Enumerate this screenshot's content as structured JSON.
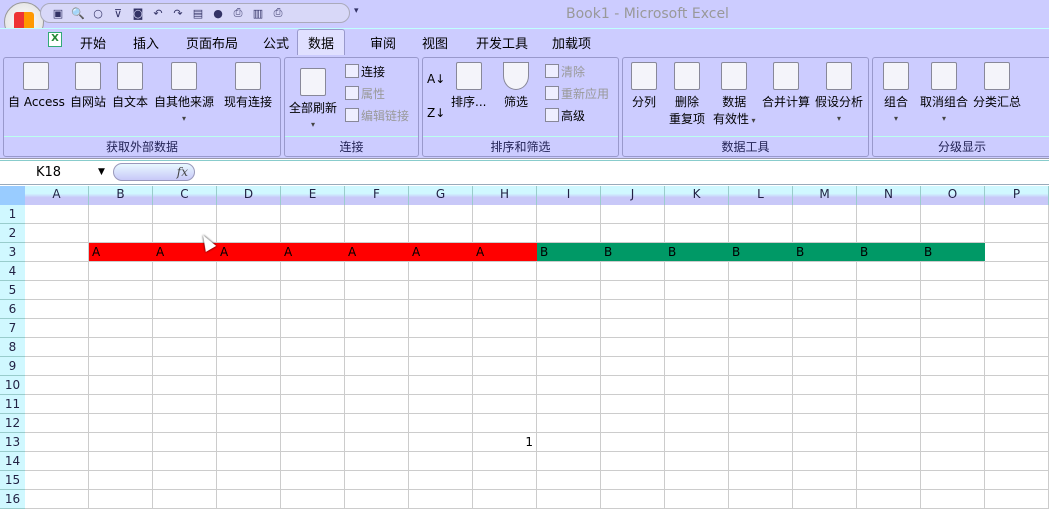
{
  "window": {
    "title": "Book1 - Microsoft Excel"
  },
  "quick_access": [
    "save-icon",
    "print-preview-icon",
    "circle-icon",
    "filter-icon",
    "camera-icon",
    "undo-icon",
    "redo-icon",
    "form-icon",
    "globe-icon",
    "print-icon",
    "chart-icon",
    "printer-check-icon"
  ],
  "tabs": [
    "开始",
    "插入",
    "页面布局",
    "公式",
    "数据",
    "审阅",
    "视图",
    "开发工具",
    "加载项"
  ],
  "active_tab": "数据",
  "ribbon": {
    "get_external": {
      "label": "获取外部数据",
      "buttons": [
        "自 Access",
        "自网站",
        "自文本",
        "自其他来源",
        "现有连接"
      ]
    },
    "connections": {
      "label": "连接",
      "refresh": "全部刷新",
      "connections": "连接",
      "properties": "属性",
      "edit_links": "编辑链接"
    },
    "sort_filter": {
      "label": "排序和筛选",
      "sort": "排序...",
      "filter": "筛选",
      "clear": "清除",
      "reapply": "重新应用",
      "advanced": "高级"
    },
    "data_tools": {
      "label": "数据工具",
      "text_to_columns": "分列",
      "remove_dup_1": "删除",
      "remove_dup_2": "重复项",
      "validation_1": "数据",
      "validation_2": "有效性",
      "consolidate": "合并计算",
      "what_if": "假设分析"
    },
    "outline": {
      "label": "分级显示",
      "group": "组合",
      "ungroup": "取消组合",
      "subtotal": "分类汇总"
    }
  },
  "formula_bar": {
    "name_box": "K18",
    "fx": "fx",
    "value": ""
  },
  "sheet": {
    "columns": [
      "A",
      "B",
      "C",
      "D",
      "E",
      "F",
      "G",
      "H",
      "I",
      "J",
      "K",
      "L",
      "M",
      "N",
      "O",
      "P"
    ],
    "rows": [
      "1",
      "2",
      "3",
      "4",
      "5",
      "6",
      "7",
      "8",
      "9",
      "10",
      "11",
      "12",
      "13",
      "14",
      "15",
      "16"
    ],
    "colors": {
      "red": "#ff0000",
      "green": "#009966"
    },
    "cells": [
      {
        "ref": "B3",
        "v": "A",
        "fill": "red"
      },
      {
        "ref": "C3",
        "v": "A",
        "fill": "red"
      },
      {
        "ref": "D3",
        "v": "A",
        "fill": "red"
      },
      {
        "ref": "E3",
        "v": "A",
        "fill": "red"
      },
      {
        "ref": "F3",
        "v": "A",
        "fill": "red"
      },
      {
        "ref": "G3",
        "v": "A",
        "fill": "red"
      },
      {
        "ref": "H3",
        "v": "A",
        "fill": "red"
      },
      {
        "ref": "I3",
        "v": "B",
        "fill": "green"
      },
      {
        "ref": "J3",
        "v": "B",
        "fill": "green"
      },
      {
        "ref": "K3",
        "v": "B",
        "fill": "green"
      },
      {
        "ref": "L3",
        "v": "B",
        "fill": "green"
      },
      {
        "ref": "M3",
        "v": "B",
        "fill": "green"
      },
      {
        "ref": "N3",
        "v": "B",
        "fill": "green"
      },
      {
        "ref": "O3",
        "v": "B",
        "fill": "green"
      },
      {
        "ref": "H13",
        "v": "1",
        "align": "right"
      }
    ]
  }
}
